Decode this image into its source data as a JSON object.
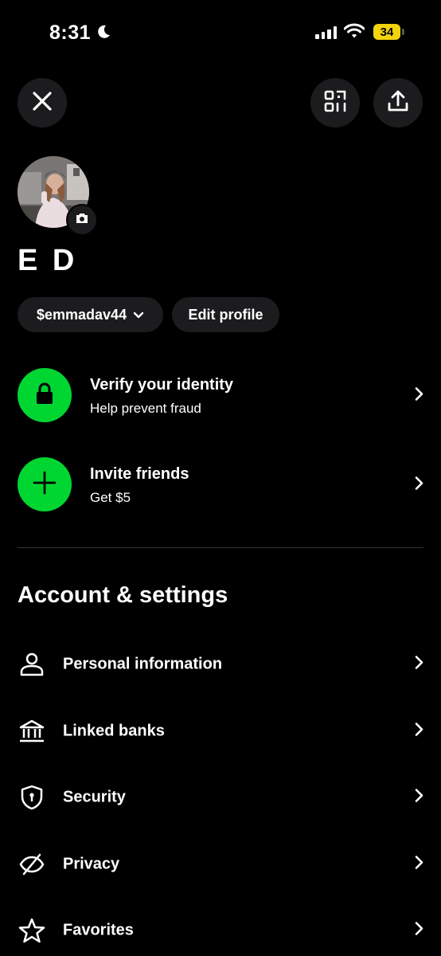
{
  "status_bar": {
    "time": "8:31",
    "battery": "34",
    "battery_color": "#f2d30d"
  },
  "header": {
    "close_icon": "close-icon",
    "qr_icon": "qr-scan-icon",
    "share_icon": "share-icon"
  },
  "profile": {
    "name": "E D",
    "cashtag": "$emmadav44",
    "edit_label": "Edit profile"
  },
  "promos": [
    {
      "title": "Verify your identity",
      "subtitle": "Help prevent fraud",
      "icon": "lock-icon"
    },
    {
      "title": "Invite friends",
      "subtitle": "Get $5",
      "icon": "plus-icon"
    }
  ],
  "accent_color": "#00d632",
  "settings": {
    "title": "Account & settings",
    "items": [
      {
        "label": "Personal information",
        "icon": "person-icon"
      },
      {
        "label": "Linked banks",
        "icon": "bank-icon"
      },
      {
        "label": "Security",
        "icon": "shield-icon"
      },
      {
        "label": "Privacy",
        "icon": "eye-slash-icon"
      },
      {
        "label": "Favorites",
        "icon": "star-icon"
      }
    ]
  }
}
